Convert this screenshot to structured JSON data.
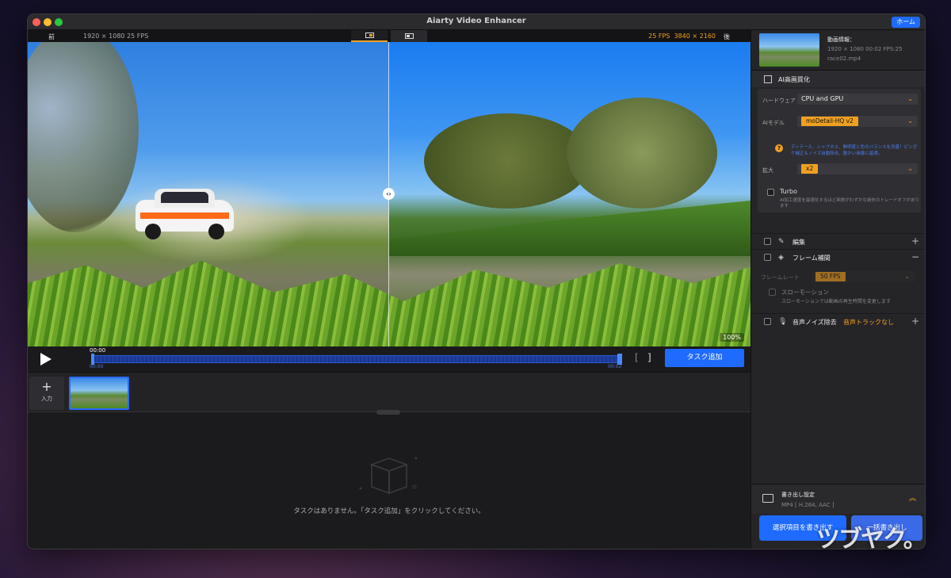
{
  "window": {
    "title": "Aiarty Video Enhancer",
    "home_label": "ホーム"
  },
  "preview": {
    "before_label": "前",
    "source_info": "1920 × 1080   25 FPS",
    "output_fps": "25 FPS",
    "output_res": "3840 × 2160",
    "after_label": "後",
    "zoom": "100%"
  },
  "playback": {
    "current_time": "00:00",
    "range_start": "00:00",
    "range_end": "00:02",
    "bracket_left": "[",
    "bracket_right": "]",
    "add_task_label": "タスク追加"
  },
  "strip": {
    "add_input_label": "入力"
  },
  "tasks": {
    "empty_message": "タスクはありません。「タスク追加」をクリックしてください。"
  },
  "panel": {
    "video_info_title": "動画情報：",
    "video_info_meta": "1920 × 1080  00:02  FPS:25",
    "video_info_file": "race02.mp4",
    "ai_section_title": "AI高画質化",
    "hardware_label": "ハードウェア",
    "hardware_value": "CPU and GPU",
    "model_label": "AIモデル",
    "model_value": "moDetail-HQ  v2",
    "model_desc": "ディテール、シャプネス、鮮明度と色のバランスを改善！ピンボケ補正＆ノイズ自動除去、動かい画像に最適。",
    "scale_label": "拡大",
    "scale_value": "x2",
    "turbo_label": "Turbo",
    "turbo_desc": "AI加工速度を最適化するほど画質がわずかな損失のトレードオフがあります",
    "edit_label": "編集",
    "frame_interp_label": "フレーム補間",
    "frame_rate_label": "フレームレート",
    "frame_rate_value": "50 FPS",
    "slowmo_label": "スローモーション",
    "slowmo_desc": "スローモーションでは動画の再生時間を変更します",
    "noise_label": "音声ノイズ除去",
    "noise_status": "音声トラックなし",
    "export_title": "書き出し設定",
    "export_format": "MP4 [ H.264, AAC ]",
    "export_selected_label": "選択項目を書き出す",
    "export_all_label": "一括書き出し"
  },
  "watermark": "ツブヤク。",
  "colors": {
    "accent_blue": "#1f6bff",
    "accent_orange": "#f0a020"
  }
}
